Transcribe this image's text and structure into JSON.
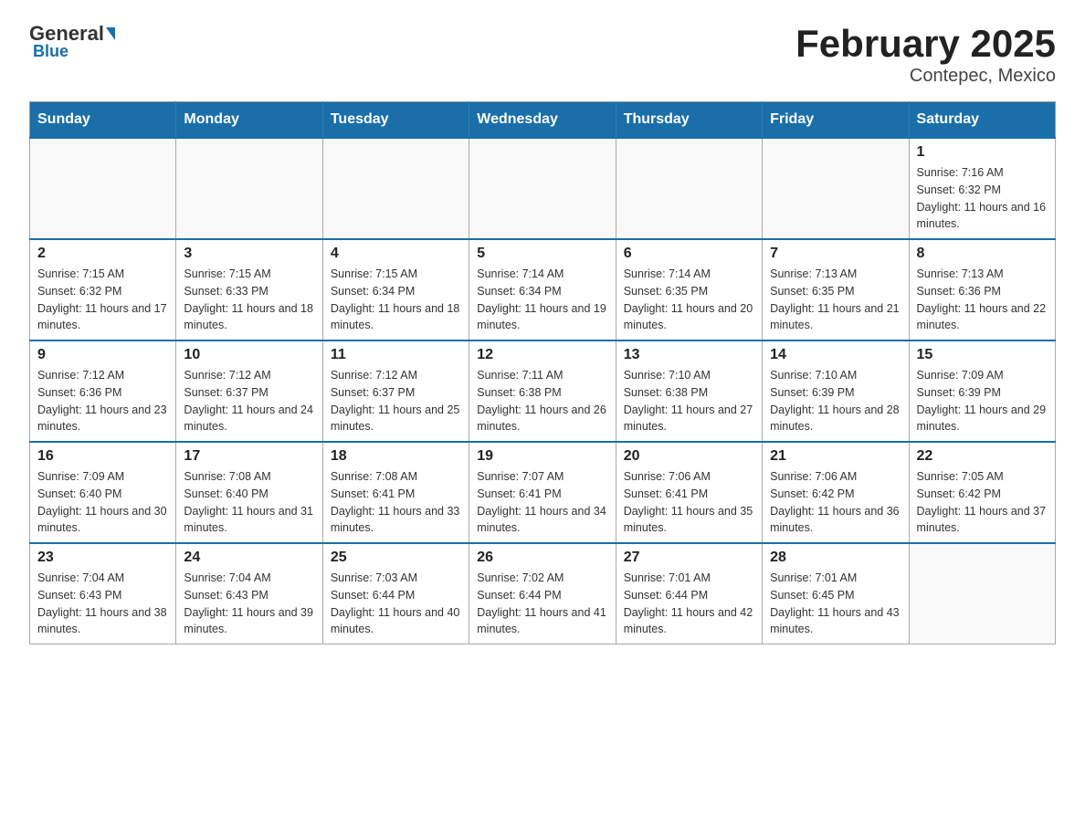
{
  "header": {
    "logo": {
      "general": "General",
      "blue": "Blue"
    },
    "title": "February 2025",
    "subtitle": "Contepec, Mexico"
  },
  "weekdays": [
    "Sunday",
    "Monday",
    "Tuesday",
    "Wednesday",
    "Thursday",
    "Friday",
    "Saturday"
  ],
  "weeks": [
    [
      {
        "day": "",
        "info": ""
      },
      {
        "day": "",
        "info": ""
      },
      {
        "day": "",
        "info": ""
      },
      {
        "day": "",
        "info": ""
      },
      {
        "day": "",
        "info": ""
      },
      {
        "day": "",
        "info": ""
      },
      {
        "day": "1",
        "info": "Sunrise: 7:16 AM\nSunset: 6:32 PM\nDaylight: 11 hours and 16 minutes."
      }
    ],
    [
      {
        "day": "2",
        "info": "Sunrise: 7:15 AM\nSunset: 6:32 PM\nDaylight: 11 hours and 17 minutes."
      },
      {
        "day": "3",
        "info": "Sunrise: 7:15 AM\nSunset: 6:33 PM\nDaylight: 11 hours and 18 minutes."
      },
      {
        "day": "4",
        "info": "Sunrise: 7:15 AM\nSunset: 6:34 PM\nDaylight: 11 hours and 18 minutes."
      },
      {
        "day": "5",
        "info": "Sunrise: 7:14 AM\nSunset: 6:34 PM\nDaylight: 11 hours and 19 minutes."
      },
      {
        "day": "6",
        "info": "Sunrise: 7:14 AM\nSunset: 6:35 PM\nDaylight: 11 hours and 20 minutes."
      },
      {
        "day": "7",
        "info": "Sunrise: 7:13 AM\nSunset: 6:35 PM\nDaylight: 11 hours and 21 minutes."
      },
      {
        "day": "8",
        "info": "Sunrise: 7:13 AM\nSunset: 6:36 PM\nDaylight: 11 hours and 22 minutes."
      }
    ],
    [
      {
        "day": "9",
        "info": "Sunrise: 7:12 AM\nSunset: 6:36 PM\nDaylight: 11 hours and 23 minutes."
      },
      {
        "day": "10",
        "info": "Sunrise: 7:12 AM\nSunset: 6:37 PM\nDaylight: 11 hours and 24 minutes."
      },
      {
        "day": "11",
        "info": "Sunrise: 7:12 AM\nSunset: 6:37 PM\nDaylight: 11 hours and 25 minutes."
      },
      {
        "day": "12",
        "info": "Sunrise: 7:11 AM\nSunset: 6:38 PM\nDaylight: 11 hours and 26 minutes."
      },
      {
        "day": "13",
        "info": "Sunrise: 7:10 AM\nSunset: 6:38 PM\nDaylight: 11 hours and 27 minutes."
      },
      {
        "day": "14",
        "info": "Sunrise: 7:10 AM\nSunset: 6:39 PM\nDaylight: 11 hours and 28 minutes."
      },
      {
        "day": "15",
        "info": "Sunrise: 7:09 AM\nSunset: 6:39 PM\nDaylight: 11 hours and 29 minutes."
      }
    ],
    [
      {
        "day": "16",
        "info": "Sunrise: 7:09 AM\nSunset: 6:40 PM\nDaylight: 11 hours and 30 minutes."
      },
      {
        "day": "17",
        "info": "Sunrise: 7:08 AM\nSunset: 6:40 PM\nDaylight: 11 hours and 31 minutes."
      },
      {
        "day": "18",
        "info": "Sunrise: 7:08 AM\nSunset: 6:41 PM\nDaylight: 11 hours and 33 minutes."
      },
      {
        "day": "19",
        "info": "Sunrise: 7:07 AM\nSunset: 6:41 PM\nDaylight: 11 hours and 34 minutes."
      },
      {
        "day": "20",
        "info": "Sunrise: 7:06 AM\nSunset: 6:41 PM\nDaylight: 11 hours and 35 minutes."
      },
      {
        "day": "21",
        "info": "Sunrise: 7:06 AM\nSunset: 6:42 PM\nDaylight: 11 hours and 36 minutes."
      },
      {
        "day": "22",
        "info": "Sunrise: 7:05 AM\nSunset: 6:42 PM\nDaylight: 11 hours and 37 minutes."
      }
    ],
    [
      {
        "day": "23",
        "info": "Sunrise: 7:04 AM\nSunset: 6:43 PM\nDaylight: 11 hours and 38 minutes."
      },
      {
        "day": "24",
        "info": "Sunrise: 7:04 AM\nSunset: 6:43 PM\nDaylight: 11 hours and 39 minutes."
      },
      {
        "day": "25",
        "info": "Sunrise: 7:03 AM\nSunset: 6:44 PM\nDaylight: 11 hours and 40 minutes."
      },
      {
        "day": "26",
        "info": "Sunrise: 7:02 AM\nSunset: 6:44 PM\nDaylight: 11 hours and 41 minutes."
      },
      {
        "day": "27",
        "info": "Sunrise: 7:01 AM\nSunset: 6:44 PM\nDaylight: 11 hours and 42 minutes."
      },
      {
        "day": "28",
        "info": "Sunrise: 7:01 AM\nSunset: 6:45 PM\nDaylight: 11 hours and 43 minutes."
      },
      {
        "day": "",
        "info": ""
      }
    ]
  ]
}
